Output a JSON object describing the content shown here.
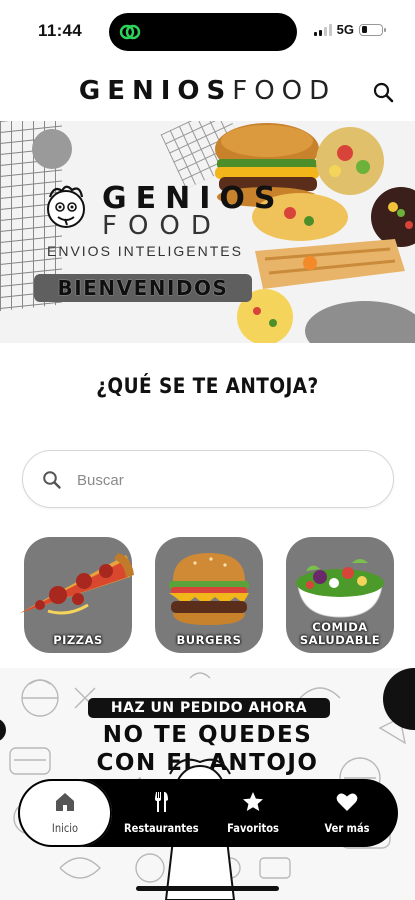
{
  "status_bar": {
    "time": "11:44",
    "network": "5G",
    "battery_level": 0.3
  },
  "header": {
    "brand_bold": "GENIOS",
    "brand_light": "FOOD",
    "search_icon": "search-icon"
  },
  "hero": {
    "title_line1": "GENIOS",
    "title_line2": "FOOD",
    "tagline": "ENVIOS INTELIGENTES",
    "welcome": "BIENVENIDOS"
  },
  "section_title": "¿QUÉ SE TE ANTOJA?",
  "search": {
    "placeholder": "Buscar",
    "value": ""
  },
  "categories": [
    {
      "label": "PIZZAS",
      "icon": "pizza-icon"
    },
    {
      "label": "BURGERS",
      "icon": "burger-icon"
    },
    {
      "label_line1": "COMIDA",
      "label_line2": "SALUDABLE",
      "icon": "salad-icon"
    }
  ],
  "promo": {
    "pill": "HAZ UN PEDIDO AHORA",
    "line1": "NO TE QUEDES",
    "line2": "CON EL ANTOJO"
  },
  "bottom_nav": [
    {
      "label": "Inicio",
      "icon": "home-icon",
      "active": true
    },
    {
      "label": "Restaurantes",
      "icon": "fork-knife-icon",
      "active": false
    },
    {
      "label": "Favoritos",
      "icon": "star-icon",
      "active": false
    },
    {
      "label": "Ver más",
      "icon": "heart-icon",
      "active": false
    }
  ],
  "colors": {
    "background": "#ffffff",
    "nav_background": "#000000",
    "category_tile": "#7a7a7a",
    "hero_background": "#f3f3f3"
  }
}
